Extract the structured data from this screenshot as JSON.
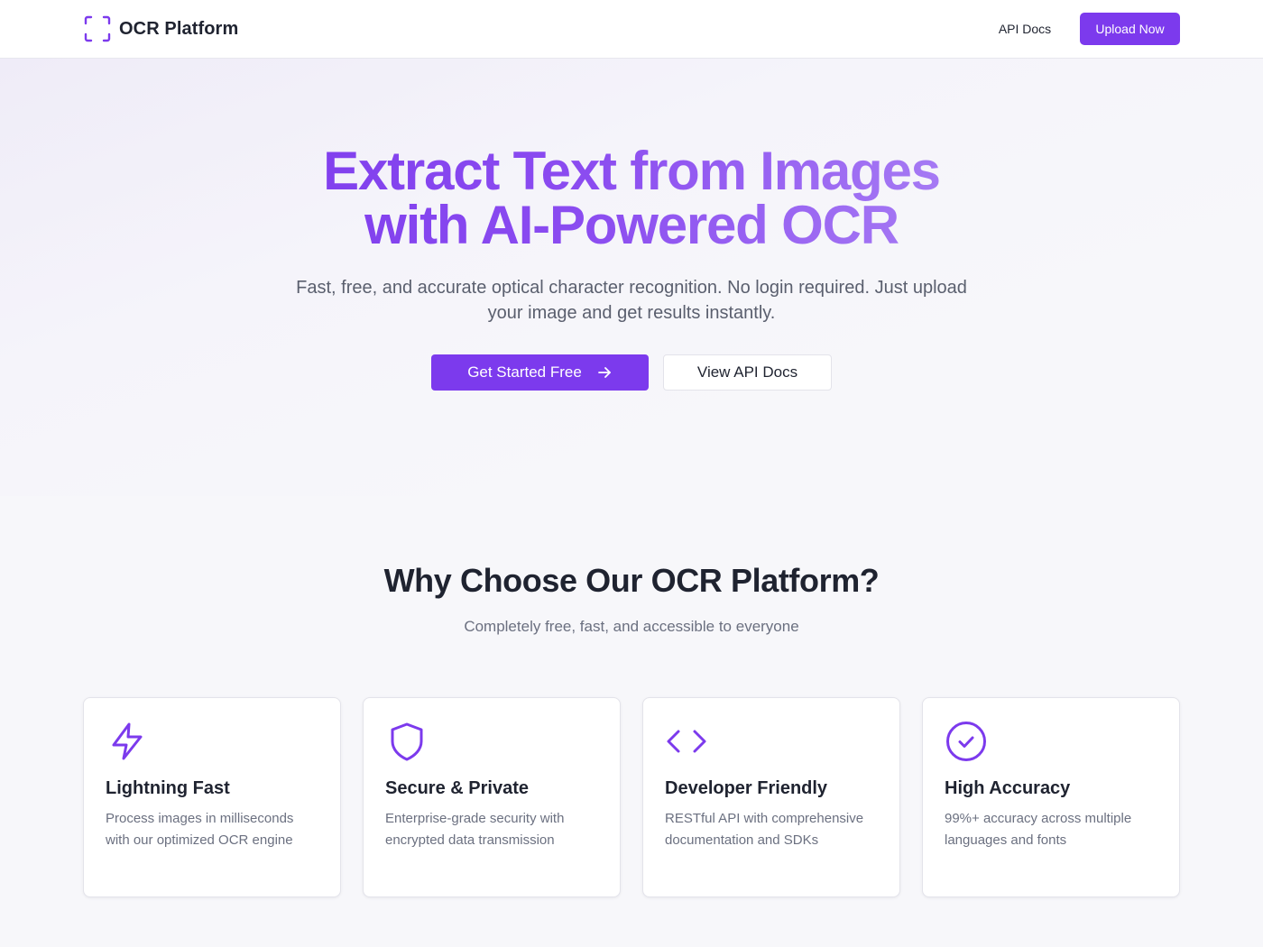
{
  "nav": {
    "brand": "OCR Platform",
    "brand_icon": "scan-frame-icon",
    "api_docs_label": "API Docs",
    "upload_label": "Upload Now"
  },
  "hero": {
    "title_line1": "Extract Text from Images",
    "title_line2": "with AI-Powered OCR",
    "subtitle": "Fast, free, and accurate optical character recognition. No login required. Just upload your image and get results instantly.",
    "primary_cta": "Get Started Free",
    "primary_cta_icon": "arrow-right-icon",
    "secondary_cta": "View API Docs"
  },
  "features": {
    "title": "Why Choose Our OCR Platform?",
    "subtitle": "Completely free, fast, and accessible to everyone",
    "cards": [
      {
        "icon": "lightning-icon",
        "title": "Lightning Fast",
        "description": "Process images in milliseconds with our optimized OCR engine"
      },
      {
        "icon": "shield-icon",
        "title": "Secure & Private",
        "description": "Enterprise-grade security with encrypted data transmission"
      },
      {
        "icon": "code-icon",
        "title": "Developer Friendly",
        "description": "RESTful API with comprehensive documentation and SDKs"
      },
      {
        "icon": "check-circle-icon",
        "title": "High Accuracy",
        "description": "99%+ accuracy across multiple languages and fonts"
      }
    ]
  },
  "colors": {
    "accent": "#7c3aed",
    "accent_light": "#b08cf5",
    "text_primary": "#1f2330",
    "text_muted": "#6b7080",
    "background": "#f7f7fa"
  }
}
